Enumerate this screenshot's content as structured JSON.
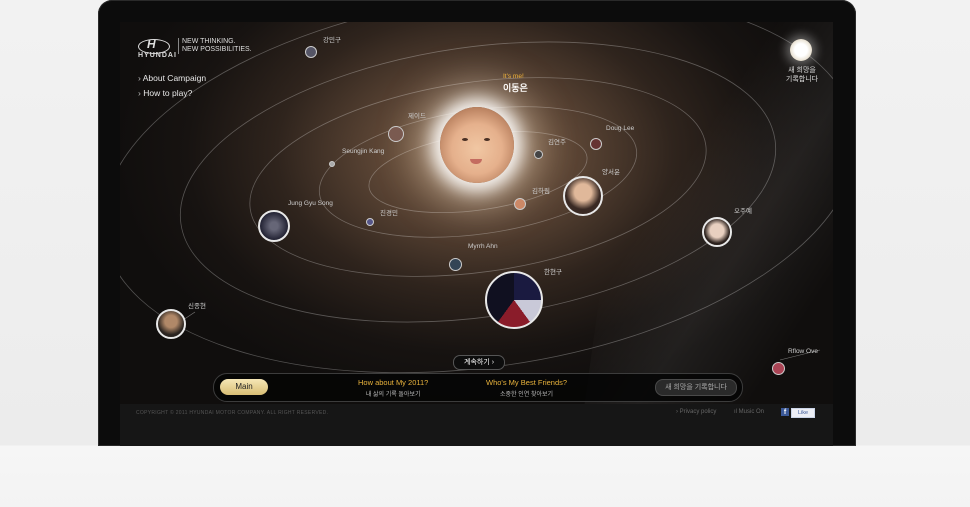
{
  "brand": {
    "logo_text": "HYUNDAI",
    "tagline_1": "NEW THINKING.",
    "tagline_2": "NEW POSSIBILITIES."
  },
  "nav": {
    "items": [
      {
        "label": "About Campaign"
      },
      {
        "label": "How to play?"
      }
    ]
  },
  "sun": {
    "label_1": "새 희망을",
    "label_2": "기록합니다"
  },
  "center": {
    "tag": "It's me!",
    "name": "이동은"
  },
  "friends": [
    {
      "name": "강민구"
    },
    {
      "name": "제이드"
    },
    {
      "name": "Seungjin Kang"
    },
    {
      "name": "김연주"
    },
    {
      "name": "Doug Lee"
    },
    {
      "name": "양서윤"
    },
    {
      "name": "김하림"
    },
    {
      "name": "Jung Gyu Song"
    },
    {
      "name": "진경민"
    },
    {
      "name": "오주예"
    },
    {
      "name": "Myrrh Ahn"
    },
    {
      "name": "한현구"
    },
    {
      "name": "신종현"
    },
    {
      "name": "Rflow Ove"
    }
  ],
  "continue_label": "계속하기",
  "bottom_bar": {
    "main": "Main",
    "menu": [
      {
        "title": "How about My 2011?",
        "sub": "내 삶의 기록 돌아보기"
      },
      {
        "title": "Who's My Best Friends?",
        "sub": "소중한 인연 찾아보기"
      }
    ],
    "write": "새 희망을 기록합니다"
  },
  "footer": {
    "copyright": "COPYRIGHT © 2011 HYUNDAI MOTOR COMPANY. ALL RIGHT RESERVED.",
    "privacy": "Privacy policy",
    "music": "Music On",
    "like": "Like"
  },
  "colors": {
    "accent": "#e8b23c",
    "button": "#d7bd74",
    "facebook": "#3b5998"
  }
}
